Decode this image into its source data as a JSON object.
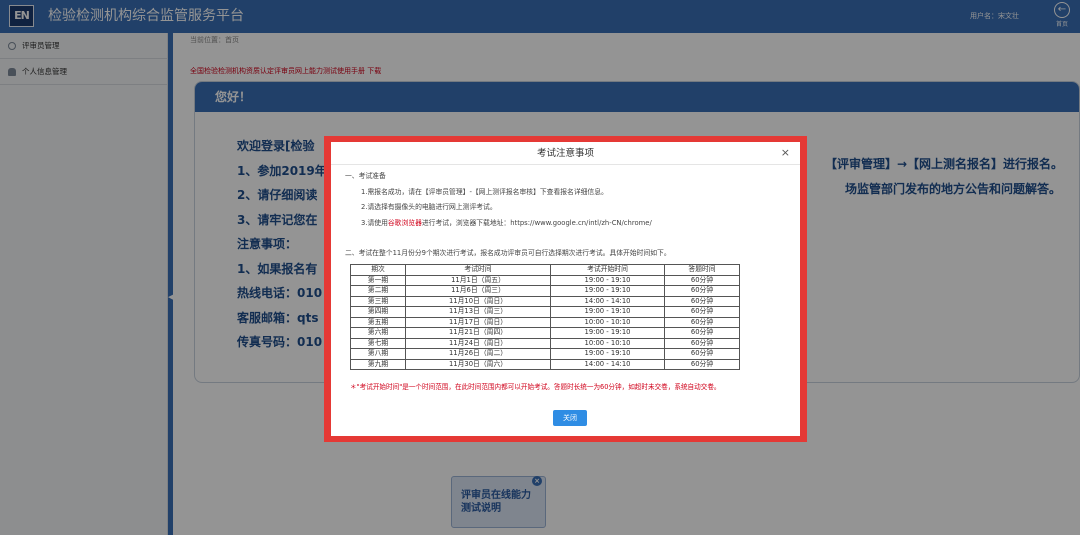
{
  "header": {
    "logo_text": "EN",
    "title": "检验检测机构综合监管服务平台",
    "user_label": "用户名：",
    "user_name": "宋文壮",
    "back_label": "首页"
  },
  "sidebar": {
    "items": [
      {
        "label": "评审员管理",
        "icon": "circle-icon"
      },
      {
        "label": "个人信息管理",
        "icon": "user-icon"
      }
    ]
  },
  "content": {
    "breadcrumb": "当前位置：首页",
    "notice_link": "全国检验检测机构资质认定评审员网上能力测试使用手册  下载",
    "welcome_title": "您好！",
    "welcome_lines": [
      "欢迎登录[检验",
      "1、参加2019年",
      "2、请仔细阅读",
      "3、请牢记您在",
      "注意事项：",
      "1、如果报名有",
      "热线电话：010",
      "客服邮箱：qts",
      "传真号码：010"
    ],
    "welcome_right": [
      "【评审管理】→【网上测名报名】进行报名。",
      "场监管部门发布的地方公告和问题解答。"
    ],
    "help_card": {
      "line1": "评审员在线能力",
      "line2": "测试说明",
      "close": "×"
    }
  },
  "modal": {
    "title": "考试注意事项",
    "close_x": "×",
    "section1": "一、考试准备",
    "prep1": "1.需报名成功，请在【评审员管理】-【网上测评报名审核】下查看报名详细信息。",
    "prep2": "2.请选择有摄像头的电脑进行网上测评考试。",
    "prep3_a": "3.请使用",
    "prep3_b": "谷歌浏览器",
    "prep3_c": "进行考试，浏览器下载地址：https://www.google.cn/intl/zh-CN/chrome/",
    "section2": "二、考试在整个11月份分9个期次进行考试，报名成功评审员可自行选择期次进行考试。具体开始时间如下。",
    "table_headers": [
      "期次",
      "考试时间",
      "考试开始时间",
      "答题时间"
    ],
    "table_rows": [
      [
        "第一期",
        "11月1日（周五）",
        "19:00 - 19:10",
        "60分钟"
      ],
      [
        "第二期",
        "11月6日（周三）",
        "19:00 - 19:10",
        "60分钟"
      ],
      [
        "第三期",
        "11月10日（周日）",
        "14:00 - 14:10",
        "60分钟"
      ],
      [
        "第四期",
        "11月13日（周三）",
        "19:00 - 19:10",
        "60分钟"
      ],
      [
        "第五期",
        "11月17日（周日）",
        "10:00 - 10:10",
        "60分钟"
      ],
      [
        "第六期",
        "11月21日（周四）",
        "19:00 - 19:10",
        "60分钟"
      ],
      [
        "第七期",
        "11月24日（周日）",
        "10:00 - 10:10",
        "60分钟"
      ],
      [
        "第八期",
        "11月26日（周二）",
        "19:00 - 19:10",
        "60分钟"
      ],
      [
        "第九期",
        "11月30日（周六）",
        "14:00 - 14:10",
        "60分钟"
      ]
    ],
    "note": "＊\"考试开始时间\"是一个时间范围，在此时间范围内都可以开始考试。答题时长统一为60分钟，如超时未交卷，系统自动交卷。",
    "close_button": "关闭"
  }
}
